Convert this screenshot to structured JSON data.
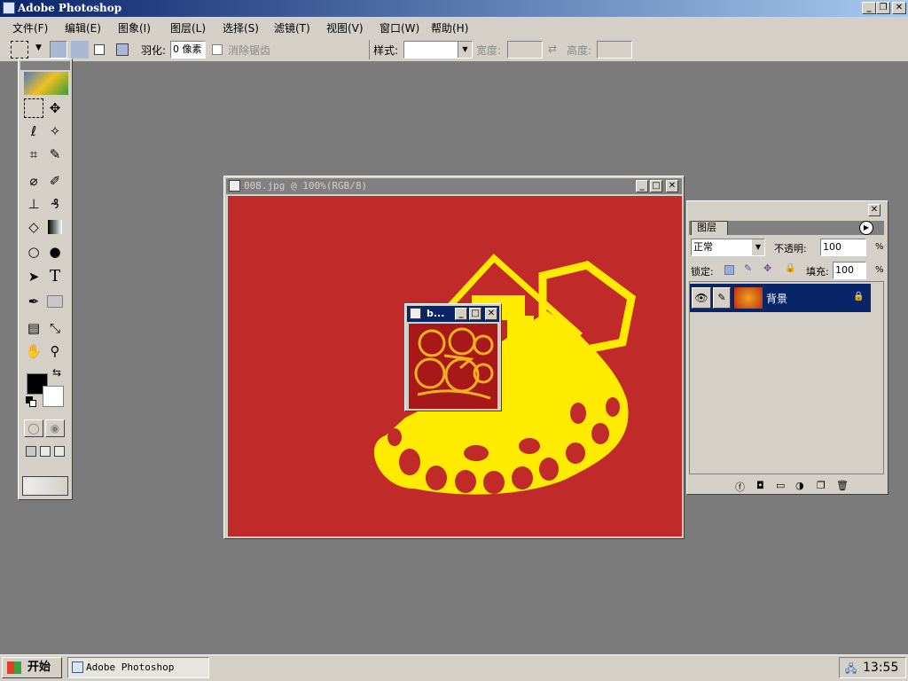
{
  "app": {
    "title": "Adobe Photoshop"
  },
  "menu": [
    "文件(F)",
    "编辑(E)",
    "图象(I)",
    "图层(L)",
    "选择(S)",
    "滤镜(T)",
    "视图(V)",
    "窗口(W)",
    "帮助(H)"
  ],
  "options": {
    "feather_label": "羽化:",
    "feather_value": "0 像素",
    "antialias_label": "消除锯齿",
    "style_label": "样式:",
    "width_label": "宽度:",
    "height_label": "高度:"
  },
  "document": {
    "title": "008.jpg @ 100%(RGB/8)"
  },
  "navigator": {
    "title": "b..."
  },
  "layers": {
    "tab": "图层",
    "blend_mode": "正常",
    "opacity_label": "不透明:",
    "opacity_value": "100",
    "percent": "%",
    "lock_label": "锁定:",
    "fill_label": "填充:",
    "fill_value": "100",
    "layer_name": "背景"
  },
  "taskbar": {
    "start": "开始",
    "task": "Adobe Photoshop",
    "time": "13:55"
  },
  "colors": {
    "canvas": "#c02a28",
    "artwork": "#ffeb00",
    "titlebar": "#0a246a",
    "selected_layer": "#0a246a"
  }
}
